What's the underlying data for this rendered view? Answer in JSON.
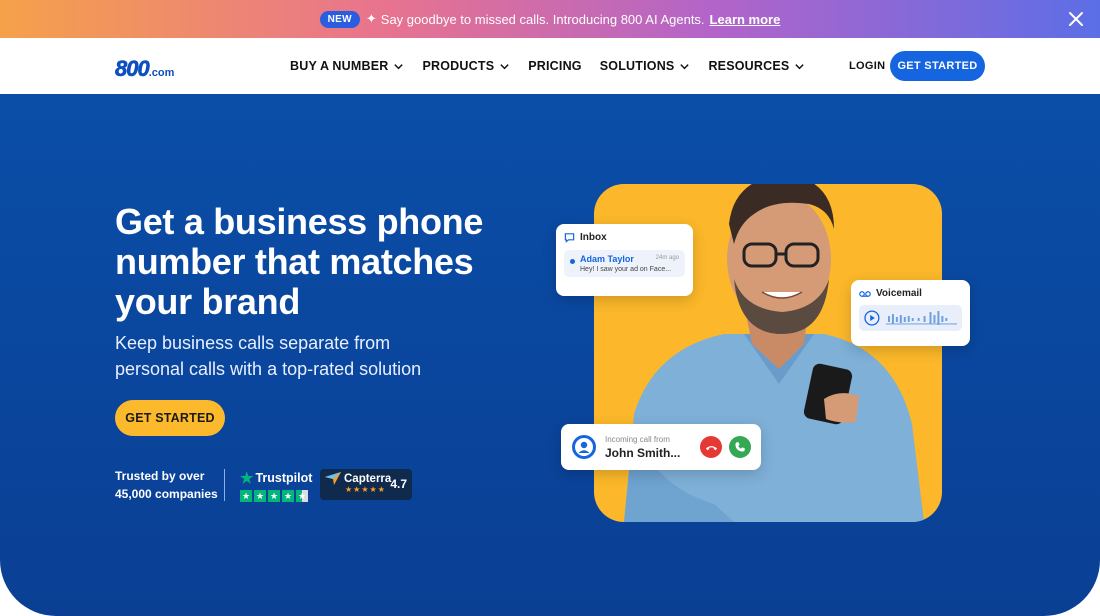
{
  "announcement": {
    "badge": "NEW",
    "message": "Say goodbye to missed calls. Introducing 800 AI Agents.",
    "link": "Learn more"
  },
  "logo": {
    "main": "800",
    "suffix": ".com"
  },
  "nav": {
    "items": [
      {
        "label": "BUY A NUMBER",
        "dropdown": true
      },
      {
        "label": "PRODUCTS",
        "dropdown": true
      },
      {
        "label": "PRICING",
        "dropdown": false
      },
      {
        "label": "SOLUTIONS",
        "dropdown": true
      },
      {
        "label": "RESOURCES",
        "dropdown": true
      }
    ],
    "login": "LOGIN",
    "cta": "GET STARTED"
  },
  "hero": {
    "headline": "Get a business phone number that matches your brand",
    "subheadline": "Keep business calls separate from personal calls with a top-rated solution",
    "cta": "GET STARTED",
    "trust_line1": "Trusted by over",
    "trust_line2": "45,000 companies",
    "trustpilot": {
      "name": "Trustpilot",
      "stars": 4.5
    },
    "capterra": {
      "name": "Capterra",
      "stars": 5,
      "rating": "4.7"
    }
  },
  "widgets": {
    "inbox": {
      "title": "Inbox",
      "sender": "Adam Taylor",
      "time": "24m ago",
      "preview": "Hey! I saw your ad on Face..."
    },
    "voicemail": {
      "title": "Voicemail"
    },
    "call": {
      "label": "Incoming call from",
      "caller": "John Smith..."
    }
  },
  "colors": {
    "brand_blue": "#1565e0",
    "hero_bg": "#0a4ea8",
    "accent_yellow": "#fdb92c",
    "decline_red": "#e53935",
    "accept_green": "#34a853"
  }
}
